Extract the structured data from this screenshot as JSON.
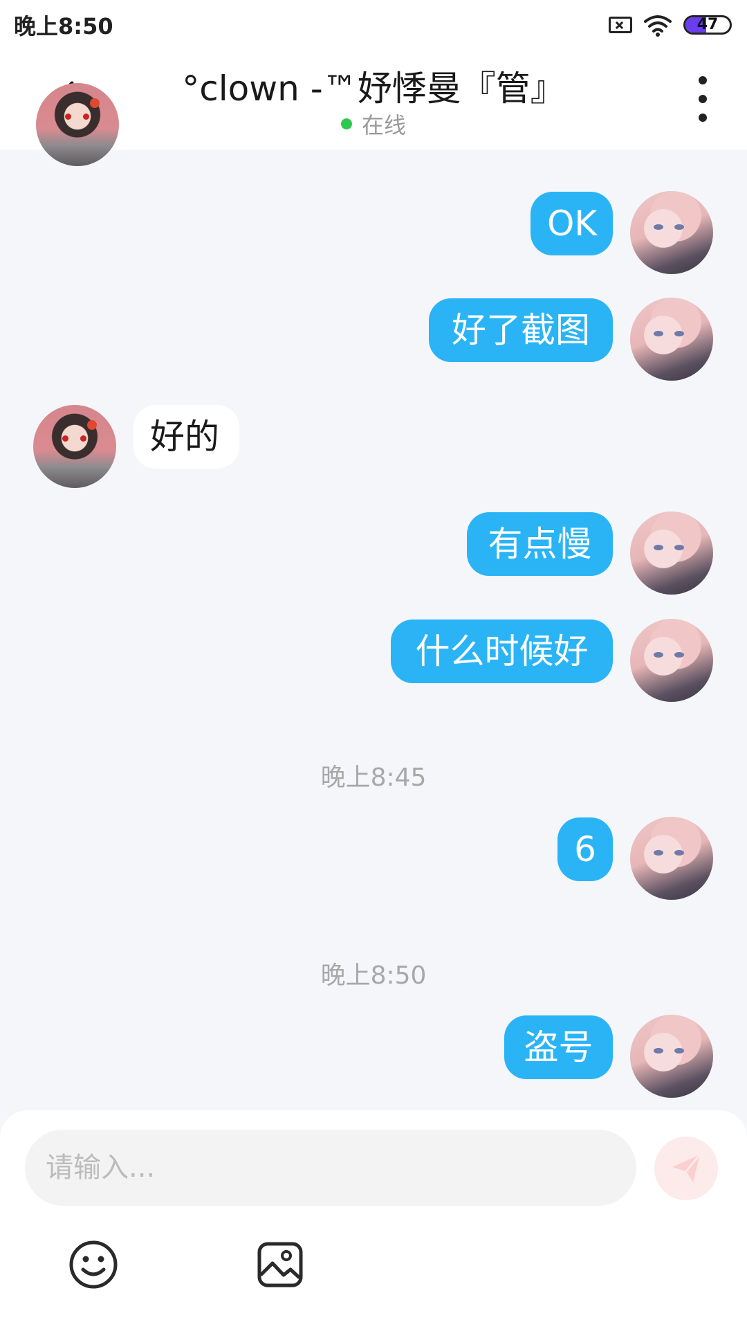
{
  "status_bar": {
    "time": "晚上8:50",
    "battery_level": "47",
    "battery_fraction": 0.47
  },
  "header": {
    "title": "°clown -™妤悸曼『管』",
    "status": "在线"
  },
  "messages": [
    {
      "side": "out",
      "text": "OK"
    },
    {
      "side": "out",
      "text": "好了截图"
    },
    {
      "side": "in",
      "text": "好的"
    },
    {
      "side": "out",
      "text": "有点慢"
    },
    {
      "side": "out",
      "text": "什么时候好"
    },
    {
      "side": "out",
      "text": "6"
    },
    {
      "side": "out",
      "text": "盗号"
    }
  ],
  "timestamps": [
    "晚上8:45",
    "晚上8:50"
  ],
  "input": {
    "placeholder": "请输入..."
  },
  "icons": {
    "back": "chevron-left-icon",
    "more": "more-vertical-icon",
    "send": "send-icon",
    "emoji": "emoji-icon",
    "image": "image-icon"
  },
  "colors": {
    "outgoing_bubble": "#2ab4f6",
    "incoming_bubble": "#ffffff",
    "online": "#2dc84d",
    "chat_background": "#f4f6f9",
    "send_button": "#fdeaea"
  }
}
